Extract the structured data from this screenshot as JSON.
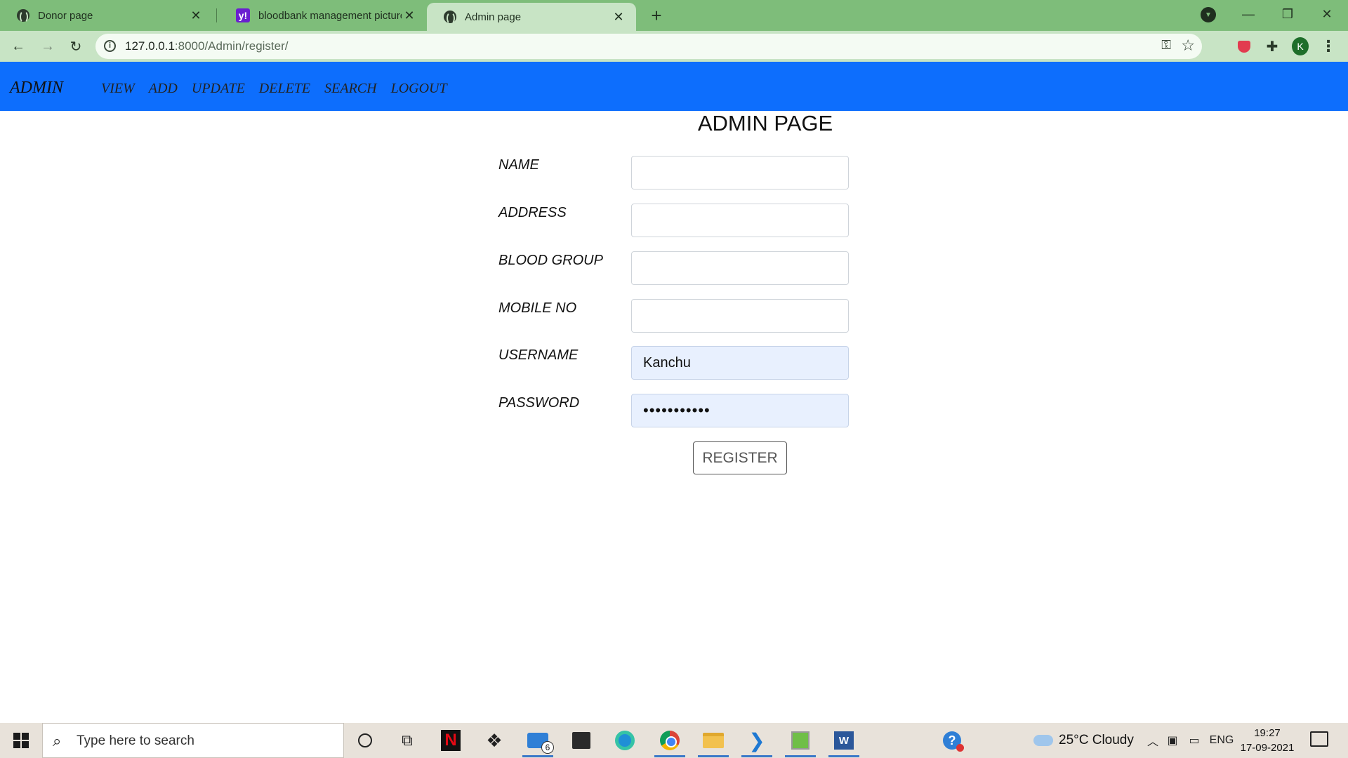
{
  "browser": {
    "tabs": [
      {
        "title": "Donor page",
        "close": "✕"
      },
      {
        "title": "bloodbank management pictures",
        "close": "✕"
      },
      {
        "title": "Admin page",
        "close": "✕"
      }
    ],
    "url_host": "127.0.0.1",
    "url_rest": ":8000/Admin/register/"
  },
  "navbar": {
    "brand": "ADMIN",
    "links": [
      "VIEW",
      "ADD",
      "UPDATE",
      "DELETE",
      "SEARCH",
      "LOGOUT"
    ]
  },
  "page": {
    "title": "ADMIN PAGE",
    "fields": [
      {
        "label": "NAME",
        "value": ""
      },
      {
        "label": "ADDRESS",
        "value": ""
      },
      {
        "label": "BLOOD GROUP",
        "value": ""
      },
      {
        "label": "MOBILE NO",
        "value": ""
      },
      {
        "label": "USERNAME",
        "value": "Kanchu"
      },
      {
        "label": "PASSWORD",
        "value": "•••••••••••"
      }
    ],
    "submit_label": "REGISTER"
  },
  "taskbar": {
    "search_placeholder": "Type here to search",
    "mail_badge": "6",
    "weather": "25°C  Cloudy",
    "language": "ENG",
    "time": "19:27",
    "date": "17-09-2021"
  },
  "colors": {
    "tabbar": "#7ebd7a",
    "navbar": "#0d6efd",
    "autofill": "#e8f0fe"
  }
}
